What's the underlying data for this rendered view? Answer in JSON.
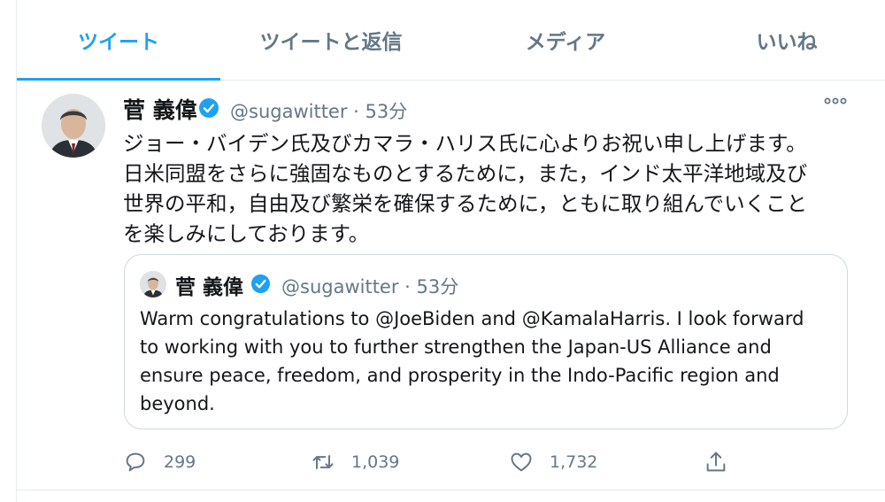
{
  "tabs": [
    {
      "label": "ツイート",
      "active": true
    },
    {
      "label": "ツイートと返信",
      "active": false
    },
    {
      "label": "メディア",
      "active": false
    },
    {
      "label": "いいね",
      "active": false
    }
  ],
  "tweet": {
    "author_name": "菅 義偉",
    "handle_time": "@sugawitter · 53分",
    "text": "ジョー・バイデン氏及びカマラ・ハリス氏に心よりお祝い申し上げます。\n日米同盟をさらに強固なものとするために，また，インド太平洋地域及び\n世界の平和，自由及び繁栄を確保するために，ともに取り組んでいくこと\nを楽しみにしております。",
    "more_icon": "more-horizontal-icon"
  },
  "quote": {
    "author_name": "菅 義偉",
    "handle_time": "@sugawitter · 53分",
    "text": "Warm congratulations to @JoeBiden and @KamalaHarris. I look forward\nto working with you to further strengthen the Japan-US Alliance and\nensure peace, freedom, and prosperity in the Indo-Pacific region and\nbeyond."
  },
  "actions": {
    "replies": "299",
    "retweets": "1,039",
    "likes": "1,732",
    "share_icon": "share-icon"
  },
  "colors": {
    "accent": "#1da1f2",
    "muted": "#657786",
    "text": "#14171a",
    "border": "#e6ecf0",
    "verified": "#1da1f2"
  }
}
